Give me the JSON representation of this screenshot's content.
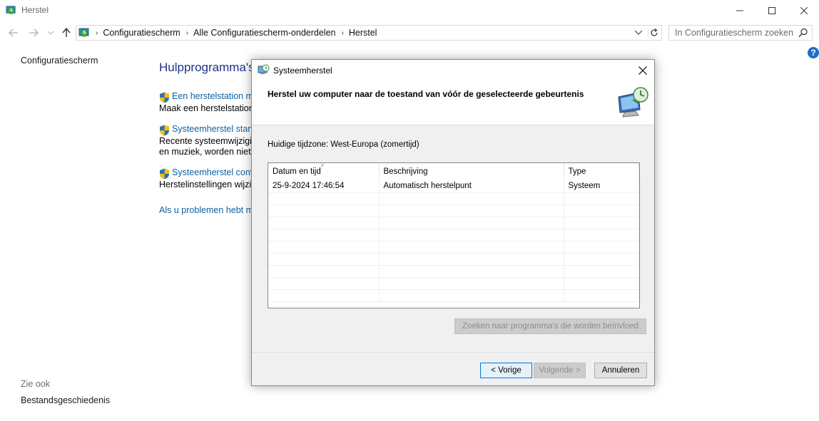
{
  "window": {
    "title": "Herstel"
  },
  "address": {
    "crumbs": [
      "Configuratiescherm",
      "Alle Configuratiescherm-onderdelen",
      "Herstel"
    ]
  },
  "search": {
    "placeholder": "In Configuratiescherm zoeken"
  },
  "left_pane": {
    "home": "Configuratiescherm",
    "see_also": "Zie ook",
    "file_history": "Bestandsgeschiedenis"
  },
  "main": {
    "heading": "Hulpprogramma's",
    "tools": [
      {
        "link": "Een herstelstation ma",
        "desc": [
          "Maak een herstelstation a"
        ]
      },
      {
        "link": "Systeemherstel starte",
        "desc": [
          "Recente systeemwijziging",
          "en muziek, worden niet g"
        ]
      },
      {
        "link": "Systeemherstel config",
        "desc": [
          "Herstelinstellingen wijzig"
        ]
      }
    ],
    "problem_link": "Als u problemen hebt m"
  },
  "dialog": {
    "title": "Systeemherstel",
    "header": "Herstel uw computer naar de toestand van vóór de geselecteerde gebeurtenis",
    "timezone": "Huidige tijdzone: West-Europa (zomertijd)",
    "columns": [
      "Datum en tijd",
      "Beschrijving",
      "Type"
    ],
    "rows": [
      [
        "25-9-2024 17:46:54",
        "Automatisch herstelpunt",
        "Systeem"
      ]
    ],
    "scan_button": "Zoeken naar programma's die worden beïnvloed",
    "back_button": "< Vorige",
    "next_button": "Volgende >",
    "cancel_button": "Annuleren"
  },
  "colors": {
    "link": "#0b61a4",
    "heading": "#1e3287",
    "accent": "#0078d7"
  }
}
